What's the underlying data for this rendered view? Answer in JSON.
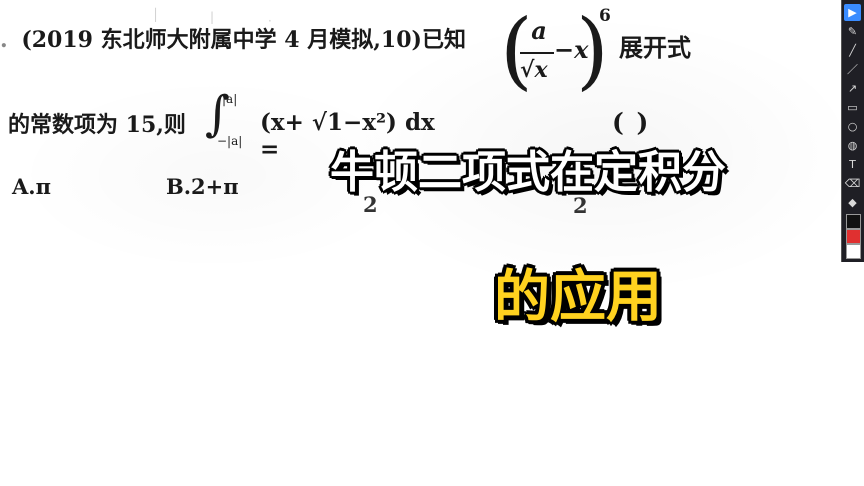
{
  "problem": {
    "prefix": ".",
    "line1_before": "(2019 东北师大附属中学 4 月模拟,10)已知",
    "fraction_numerator": "a",
    "fraction_denominator": "√x",
    "minus_term": "−x",
    "exponent": "6",
    "line1_after": "展开式",
    "line2_before": "的常数项为 15,则",
    "integral_upper": "|a|",
    "integral_lower": "−|a|",
    "integrand": "(x+ √1−x²) dx =",
    "answer_blank": "(    )",
    "option_a": "A.π",
    "option_b": "B.2+π",
    "stray_left": "2",
    "stray_right": "2"
  },
  "overlay": {
    "title": "牛顿二项式在定积分",
    "subtitle": "的应用"
  },
  "toolbar": {
    "tools": [
      {
        "icon": "pointer-icon",
        "glyph": "▶"
      },
      {
        "icon": "pen-icon",
        "glyph": "✎"
      },
      {
        "icon": "highlighter-icon",
        "glyph": "╱"
      },
      {
        "icon": "line-icon",
        "glyph": "／"
      },
      {
        "icon": "arrow-icon",
        "glyph": "↗"
      },
      {
        "icon": "rectangle-icon",
        "glyph": "▭"
      },
      {
        "icon": "ellipse-icon",
        "glyph": "○"
      },
      {
        "icon": "fill-icon",
        "glyph": "◍"
      },
      {
        "icon": "text-icon",
        "glyph": "T"
      },
      {
        "icon": "eraser-icon",
        "glyph": "⌫"
      },
      {
        "icon": "shapes-icon",
        "glyph": "◆"
      }
    ],
    "colors": [
      "#111111",
      "#e03030",
      "#ffffff",
      "#ffd21f"
    ]
  }
}
